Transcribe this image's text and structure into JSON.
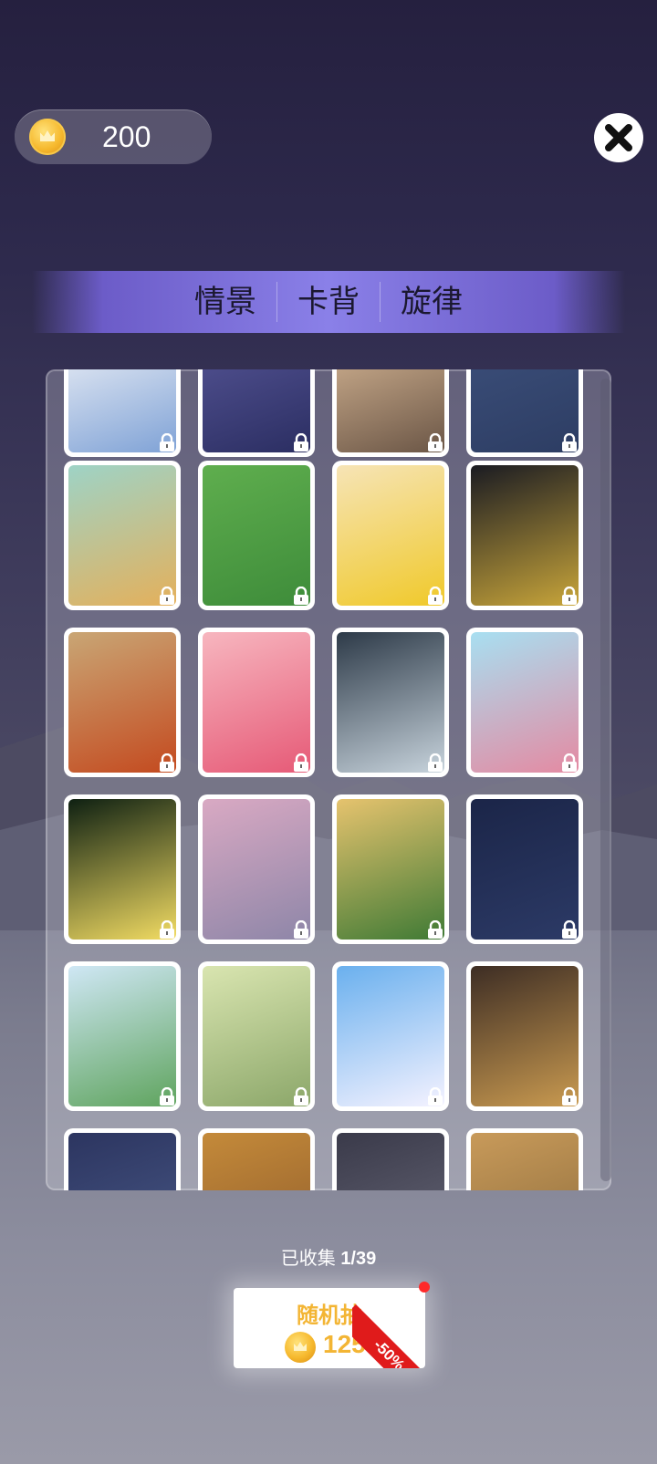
{
  "currency": {
    "amount": "200",
    "icon": "crown-coin-icon"
  },
  "close": {
    "icon": "close-icon"
  },
  "tabs": [
    {
      "label": "情景",
      "active": false
    },
    {
      "label": "卡背",
      "active": true
    },
    {
      "label": "旋律",
      "active": false
    }
  ],
  "collection": {
    "label": "已收集",
    "count": "1/39"
  },
  "draw_button": {
    "label": "随机抽",
    "price": "125",
    "discount": "-50%"
  },
  "cards": [
    {
      "name": "anime-girl-white-dress",
      "locked": true,
      "colors": [
        "#dfe6f2",
        "#7fa2d6"
      ]
    },
    {
      "name": "night-field",
      "locked": true,
      "colors": [
        "#4f4f8e",
        "#2b2e62"
      ]
    },
    {
      "name": "moon-rocks",
      "locked": true,
      "colors": [
        "#c7a98a",
        "#6b5646"
      ]
    },
    {
      "name": "navy-pattern",
      "locked": true,
      "colors": [
        "#3a4d78",
        "#2d3d63"
      ]
    },
    {
      "name": "mountain-river",
      "locked": true,
      "colors": [
        "#9ed3c6",
        "#e4b05b"
      ]
    },
    {
      "name": "park-path",
      "locked": true,
      "colors": [
        "#5fae4e",
        "#3e8c3a"
      ]
    },
    {
      "name": "blonde-girl",
      "locked": true,
      "colors": [
        "#f6e4b6",
        "#f0c92a"
      ]
    },
    {
      "name": "night-hills",
      "locked": true,
      "colors": [
        "#1a1b22",
        "#c8a53a"
      ]
    },
    {
      "name": "desert-dunes",
      "locked": true,
      "colors": [
        "#c9a675",
        "#c44a1f"
      ]
    },
    {
      "name": "pink-flower-girl",
      "locked": true,
      "colors": [
        "#f7b6bf",
        "#e65a77"
      ]
    },
    {
      "name": "tulip-ice",
      "locked": true,
      "colors": [
        "#2d3a48",
        "#c7d3dc"
      ]
    },
    {
      "name": "winter-forest-girl",
      "locked": true,
      "colors": [
        "#a8dff1",
        "#e48aa2"
      ]
    },
    {
      "name": "lilies",
      "locked": true,
      "colors": [
        "#0e2012",
        "#f2dc63"
      ]
    },
    {
      "name": "pink-mountains",
      "locked": true,
      "colors": [
        "#d9a9c3",
        "#8e86a8"
      ]
    },
    {
      "name": "pine-forest",
      "locked": true,
      "colors": [
        "#e6c36e",
        "#3f7a35"
      ]
    },
    {
      "name": "space-planets",
      "locked": true,
      "colors": [
        "#1b2548",
        "#2c3a66"
      ]
    },
    {
      "name": "spring-reeds",
      "locked": true,
      "colors": [
        "#cfe7f5",
        "#5fa45e"
      ]
    },
    {
      "name": "frog-pond",
      "locked": true,
      "colors": [
        "#d9e5b0",
        "#8ca76a"
      ]
    },
    {
      "name": "cloud-cat",
      "locked": true,
      "colors": [
        "#6ab0ee",
        "#f4f2ff"
      ]
    },
    {
      "name": "armored-girl",
      "locked": true,
      "colors": [
        "#3d2d24",
        "#c99a50"
      ]
    },
    {
      "name": "partial-1",
      "locked": true,
      "colors": [
        "#2c3560",
        "#4a5a88"
      ]
    },
    {
      "name": "partial-2",
      "locked": true,
      "colors": [
        "#c48a3a",
        "#8d5a2a"
      ]
    },
    {
      "name": "partial-3",
      "locked": true,
      "colors": [
        "#3a3a4a",
        "#6a6a7a"
      ]
    },
    {
      "name": "partial-4",
      "locked": true,
      "colors": [
        "#c89a5a",
        "#8a6a3a"
      ]
    }
  ]
}
